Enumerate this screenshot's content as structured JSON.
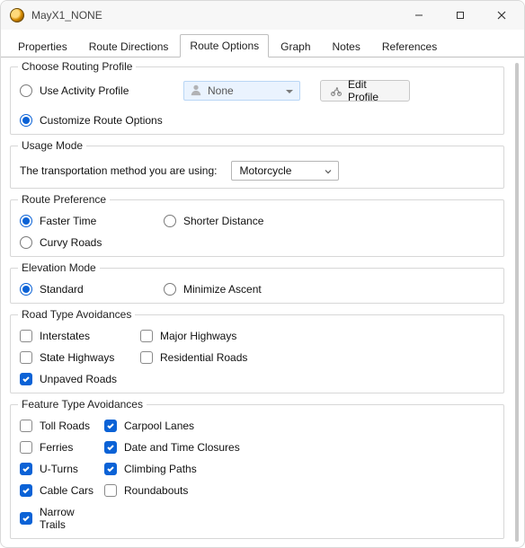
{
  "window": {
    "title": "MayX1_NONE"
  },
  "tabs": [
    {
      "label": "Properties"
    },
    {
      "label": "Route Directions"
    },
    {
      "label": "Route Options"
    },
    {
      "label": "Graph"
    },
    {
      "label": "Notes"
    },
    {
      "label": "References"
    }
  ],
  "activeTabIndex": 2,
  "routingProfile": {
    "legend": "Choose Routing Profile",
    "useActivity": {
      "label": "Use Activity Profile",
      "selected": false
    },
    "profileSelect": {
      "value": "None"
    },
    "editProfile": {
      "label": "Edit Profile"
    },
    "customize": {
      "label": "Customize Route Options",
      "selected": true
    }
  },
  "usageMode": {
    "legend": "Usage Mode",
    "label": "The transportation method you are using:",
    "value": "Motorcycle"
  },
  "routePreference": {
    "legend": "Route Preference",
    "options": [
      {
        "label": "Faster Time",
        "selected": true
      },
      {
        "label": "Shorter Distance",
        "selected": false
      },
      {
        "label": "Curvy Roads",
        "selected": false
      }
    ]
  },
  "elevationMode": {
    "legend": "Elevation Mode",
    "options": [
      {
        "label": "Standard",
        "selected": true
      },
      {
        "label": "Minimize Ascent",
        "selected": false
      }
    ]
  },
  "roadAvoid": {
    "legend": "Road Type Avoidances",
    "items": [
      {
        "label": "Interstates",
        "checked": false
      },
      {
        "label": "Major Highways",
        "checked": false
      },
      {
        "label": "State Highways",
        "checked": false
      },
      {
        "label": "Residential Roads",
        "checked": false
      },
      {
        "label": "Unpaved Roads",
        "checked": true
      }
    ]
  },
  "featureAvoid": {
    "legend": "Feature Type Avoidances",
    "items": [
      {
        "label": "Toll Roads",
        "checked": false
      },
      {
        "label": "Carpool Lanes",
        "checked": true
      },
      {
        "label": "Ferries",
        "checked": false
      },
      {
        "label": "Date and Time Closures",
        "checked": true
      },
      {
        "label": "U-Turns",
        "checked": true
      },
      {
        "label": "Climbing Paths",
        "checked": true
      },
      {
        "label": "Cable Cars",
        "checked": true
      },
      {
        "label": "Roundabouts",
        "checked": false
      },
      {
        "label": "Narrow Trails",
        "checked": true
      }
    ]
  }
}
